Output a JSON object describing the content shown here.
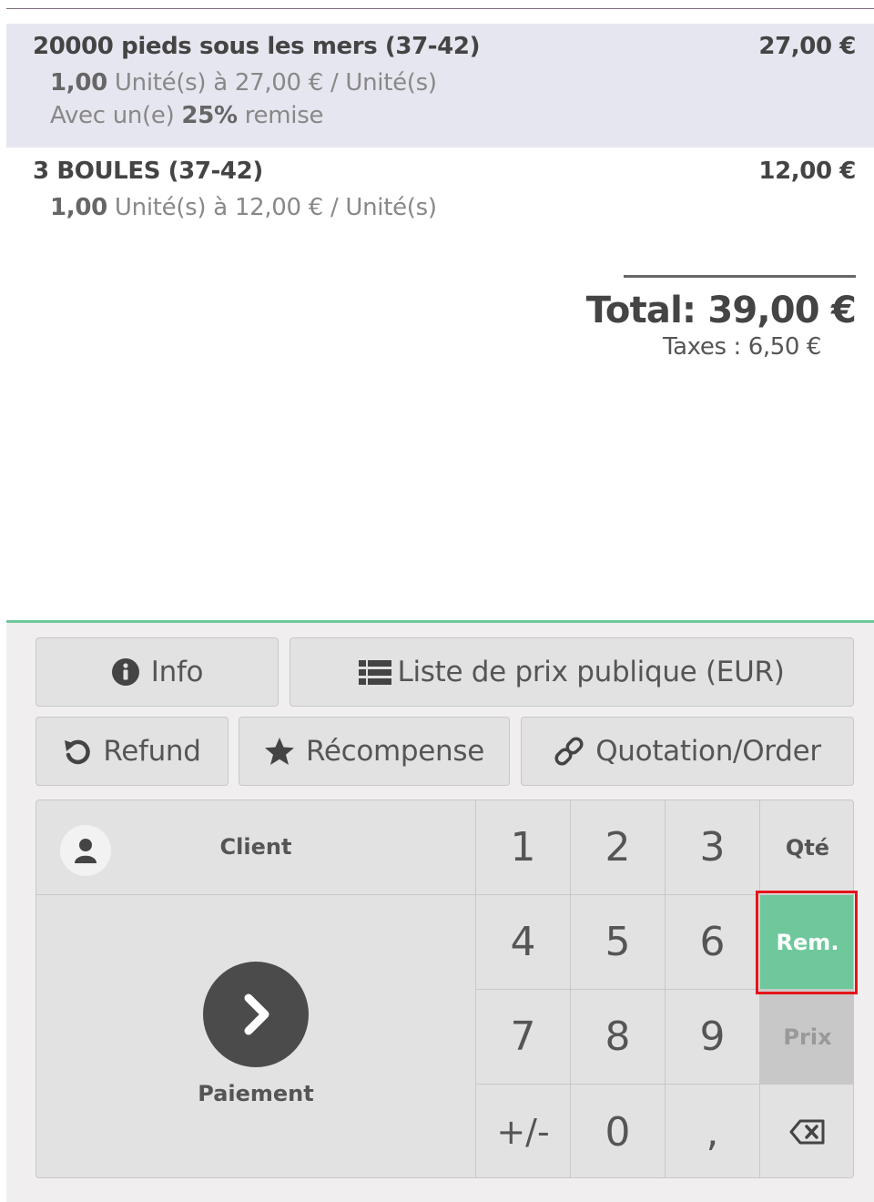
{
  "order": {
    "lines": [
      {
        "name": "20000 pieds sous les mers (37-42)",
        "price": "27,00 €",
        "qty": "1,00",
        "qty_rest": " Unité(s) à 27,00 € / Unité(s)",
        "discount_prefix": "Avec un(e) ",
        "discount_value": "25%",
        "discount_suffix": " remise"
      },
      {
        "name": "3 BOULES (37-42)",
        "price": "12,00 €",
        "qty": "1,00",
        "qty_rest": " Unité(s) à 12,00 € / Unité(s)"
      }
    ],
    "total": "Total: 39,00 €",
    "taxes": "Taxes : 6,50 €"
  },
  "controls": {
    "info_label": "Info",
    "pricelist_label": "Liste de prix publique (EUR)",
    "refund_label": "Refund",
    "reward_label": "Récompense",
    "quotation_label": "Quotation/Order"
  },
  "actionpad": {
    "client_label": "Client",
    "payment_label": "Paiement"
  },
  "numpad": {
    "keys": [
      "1",
      "2",
      "3",
      "Qté",
      "4",
      "5",
      "6",
      "Rem.",
      "7",
      "8",
      "9",
      "Prix",
      "+/-",
      "0",
      ","
    ],
    "active_mode": "Rem.",
    "disabled_mode": "Prix"
  },
  "colors": {
    "accent": "#6ec89b",
    "selected_line": "#e6e6f0",
    "highlight": "#e5151b",
    "pay_circle": "#4b4b4b"
  },
  "icons": {
    "info": "info-circle-icon",
    "pricelist": "list-icon",
    "refund": "undo-icon",
    "reward": "star-icon",
    "quotation": "link-icon",
    "client": "user-icon",
    "payment": "chevron-right-icon",
    "backspace": "backspace-icon"
  }
}
